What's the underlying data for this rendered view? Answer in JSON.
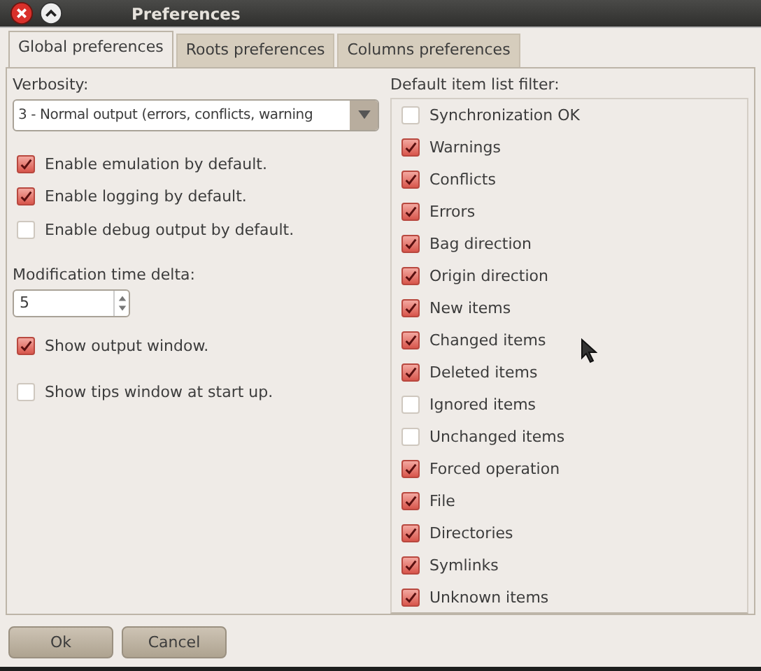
{
  "window": {
    "title": "Preferences"
  },
  "tabs": [
    {
      "label": "Global preferences",
      "selected": true
    },
    {
      "label": "Roots preferences",
      "selected": false
    },
    {
      "label": "Columns preferences",
      "selected": false
    }
  ],
  "global": {
    "verbosity": {
      "label": "Verbosity:",
      "value": "3 - Normal output (errors, conflicts, warning"
    },
    "options": [
      {
        "label": "Enable emulation by default.",
        "checked": true
      },
      {
        "label": "Enable logging by default.",
        "checked": true
      },
      {
        "label": "Enable debug output by default.",
        "checked": false
      }
    ],
    "time_delta": {
      "label": "Modification time delta:",
      "value": "5"
    },
    "window_options": [
      {
        "label": "Show output window.",
        "checked": true
      },
      {
        "label": "Show tips window at start up.",
        "checked": false
      }
    ]
  },
  "filter": {
    "label": "Default item list filter:",
    "items": [
      {
        "label": "Synchronization OK",
        "checked": false
      },
      {
        "label": "Warnings",
        "checked": true
      },
      {
        "label": "Conflicts",
        "checked": true
      },
      {
        "label": "Errors",
        "checked": true
      },
      {
        "label": "Bag direction",
        "checked": true
      },
      {
        "label": "Origin direction",
        "checked": true
      },
      {
        "label": "New items",
        "checked": true
      },
      {
        "label": "Changed items",
        "checked": true
      },
      {
        "label": "Deleted items",
        "checked": true
      },
      {
        "label": "Ignored items",
        "checked": false
      },
      {
        "label": "Unchanged items",
        "checked": false
      },
      {
        "label": "Forced operation",
        "checked": true
      },
      {
        "label": "File",
        "checked": true
      },
      {
        "label": "Directories",
        "checked": true
      },
      {
        "label": "Symlinks",
        "checked": true
      },
      {
        "label": "Unknown items",
        "checked": true
      }
    ]
  },
  "buttons": [
    "Ok",
    "Cancel"
  ]
}
